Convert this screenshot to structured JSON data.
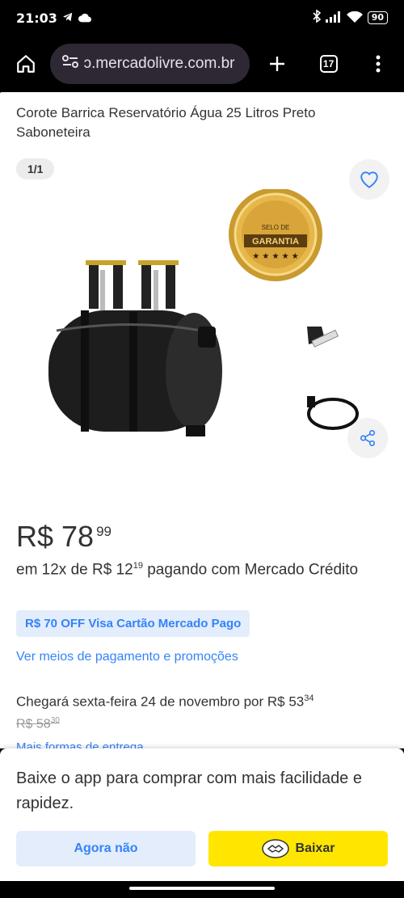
{
  "status": {
    "time": "21:03",
    "battery": "90"
  },
  "browser": {
    "url": "ɔ.mercadolivre.com.br",
    "tab_count": "17"
  },
  "product": {
    "title": "Corote Barrica Reservatório Água 25 Litros Preto Saboneteira",
    "image_counter": "1/1",
    "seal_line1": "SELO DE",
    "seal_line2": "GARANTIA",
    "price_main": "R$ 78",
    "price_cents": "99",
    "installments_prefix": "em 12x de R$ 12",
    "installments_cents": "19",
    "installments_suffix": " pagando com Mercado Crédito",
    "promo": "R$ 70 OFF Visa Cartão Mercado Pago",
    "payment_link": "Ver meios de pagamento e promoções",
    "shipping_text": "Chegará sexta-feira 24 de novembro por R$ 53",
    "shipping_cents": "34",
    "old_shipping": "R$ 58",
    "old_shipping_cents": "30",
    "more_shipping": "Mais formas de entrega"
  },
  "banner": {
    "message": "Baixe o app para comprar com mais facilidade e rapidez.",
    "decline_label": "Agora não",
    "download_label": "Baixar"
  },
  "colors": {
    "accent_blue": "#3483fa",
    "brand_yellow": "#ffe600"
  }
}
